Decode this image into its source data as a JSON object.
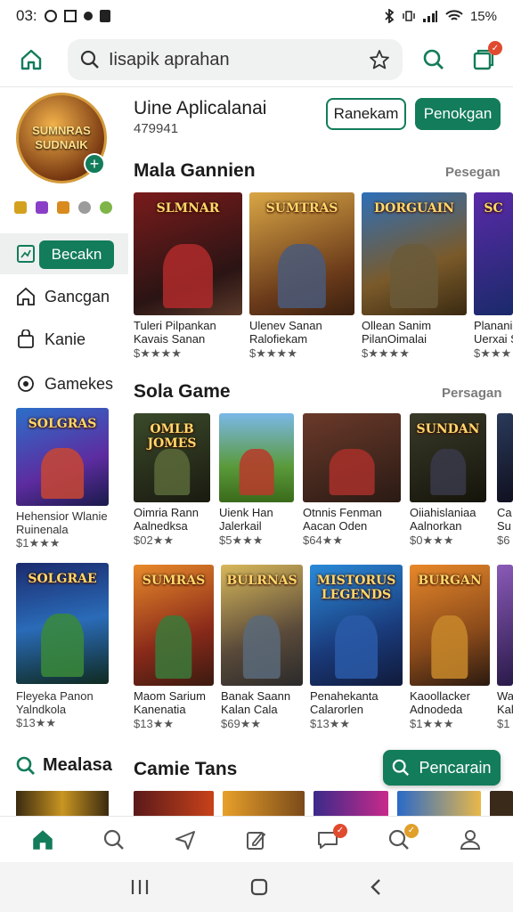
{
  "status_bar": {
    "time": "03:",
    "battery": "15%"
  },
  "search": {
    "query": "Iisapik aprahan"
  },
  "profile": {
    "app_title": "Uine Aplicalanai",
    "app_subtitle": "479941",
    "avatar_text": "SUMNRAS SUDNAIK",
    "btn_outline": "Ranekam",
    "btn_fill": "Penokgan"
  },
  "sidebar": {
    "active_label": "Becakn",
    "items": [
      {
        "label": "Gancgan"
      },
      {
        "label": "Kanie"
      },
      {
        "label": "Gamekes"
      }
    ],
    "game1": {
      "title": "Hehensior Wlanie",
      "subtitle": "Ruinenala",
      "price": "$1★★★",
      "logo": "SOLGRAS"
    },
    "game2": {
      "title": "Fleyeka Panon",
      "subtitle": "Yalndkola",
      "price": "$13★★",
      "logo": "SOLGRAE"
    },
    "more_label": "Mealasa"
  },
  "sections": [
    {
      "title": "Mala Gannien",
      "link": "Pesegan",
      "cards": [
        {
          "logo": "SLMNAR",
          "t1": "Tuleri Pilpankan",
          "t2": "Kavais Sanan",
          "price": "$★★★★"
        },
        {
          "logo": "SUMTRAS",
          "t1": "Ulenev Sanan",
          "t2": "Ralofiekam",
          "price": "$★★★★"
        },
        {
          "logo": "DORGUAIN",
          "t1": "Ollean Sanim",
          "t2": "PilanOimalai",
          "price": "$★★★★"
        },
        {
          "logo": "SC",
          "t1": "Planani A",
          "t2": "Uerxai S",
          "price": "$★★★"
        }
      ]
    },
    {
      "title": "Sola Game",
      "link": "Persagan",
      "cards": [
        {
          "logo": "OMLB JOMES",
          "t1": "Oimria Rann",
          "t2": "Aalnedksa",
          "price": "$02★★"
        },
        {
          "logo": "",
          "t1": "Uienk Han",
          "t2": "Jalerkail",
          "price": "$5★★★"
        },
        {
          "logo": "",
          "t1": "Otnnis Fenman",
          "t2": "Aacan Oden",
          "price": "$64★★"
        },
        {
          "logo": "SUNDAN",
          "t1": "Oiiahislaniaa",
          "t2": "Aalnorkan",
          "price": "$0★★★"
        },
        {
          "logo": "",
          "t1": "Ca",
          "t2": "Su",
          "price": "$6"
        }
      ]
    },
    {
      "title": "",
      "link": "",
      "cards": [
        {
          "logo": "SUMRAS",
          "t1": "Maom Sarium",
          "t2": "Kanenatia",
          "price": "$13★★"
        },
        {
          "logo": "BULRNAS",
          "t1": "Banak Saann",
          "t2": "Kalan Cala",
          "price": "$69★★"
        },
        {
          "logo": "MISTORUS LEGENDS",
          "t1": "Penahekanta",
          "t2": "Calarorlen",
          "price": "$13★★"
        },
        {
          "logo": "BURGAN",
          "t1": "Kaoollacker",
          "t2": "Adnodeda",
          "price": "$1★★★"
        },
        {
          "logo": "",
          "t1": "Wa",
          "t2": "Kal",
          "price": "$1"
        }
      ]
    }
  ],
  "bottom_section_title": "Camie Tans",
  "fab_label": "Pencarain",
  "colors": {
    "accent": "#137c5a",
    "badge": "#e04a2f"
  }
}
